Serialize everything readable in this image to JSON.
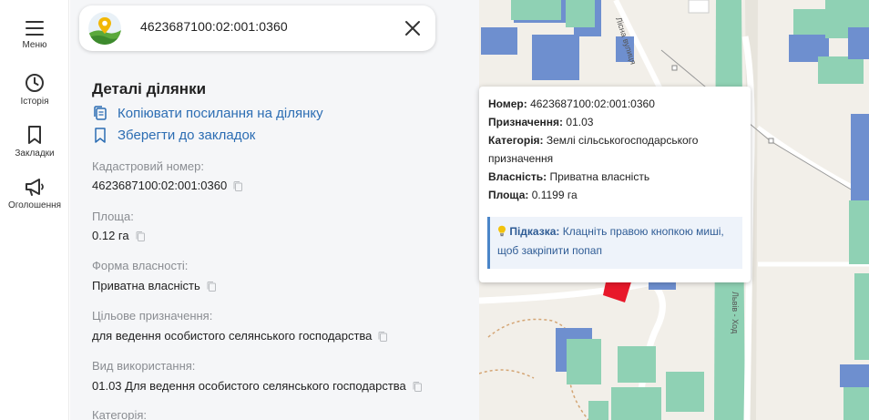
{
  "sidebar": {
    "items": [
      {
        "label": "Меню",
        "icon": "menu-icon"
      },
      {
        "label": "Історія",
        "icon": "clock-icon"
      },
      {
        "label": "Закладки",
        "icon": "bookmark-icon"
      },
      {
        "label": "Оголошення",
        "icon": "megaphone-icon"
      }
    ]
  },
  "search": {
    "value": "4623687100:02:001:0360"
  },
  "details": {
    "title": "Деталі ділянки",
    "copy_link_label": "Копіювати посилання на ділянку",
    "bookmark_label": "Зберегти до закладок",
    "fields": [
      {
        "label": "Кадастровий номер:",
        "value": "4623687100:02:001:0360"
      },
      {
        "label": "Площа:",
        "value": "0.12 га"
      },
      {
        "label": "Форма власності:",
        "value": "Приватна власність"
      },
      {
        "label": "Цільове призначення:",
        "value": "для ведення особистого селянського господарства"
      },
      {
        "label": "Вид використання:",
        "value": "01.03 Для ведення особистого селянського господарства"
      },
      {
        "label": "Категорія:",
        "value": ""
      }
    ]
  },
  "popup": {
    "number_label": "Номер:",
    "number": "4623687100:02:001:0360",
    "purpose_label": "Призначення:",
    "purpose": "01.03",
    "category_label": "Категорія:",
    "category_line1": "Землі сільськогосподарського",
    "category_line2": "призначення",
    "ownership_label": "Власність:",
    "ownership": "Приватна власність",
    "area_label": "Площа:",
    "area": "0.1199 га",
    "hint_label": "Підказка:",
    "hint_line1": "Клацніть правою кнопкою миші,",
    "hint_line2": "щоб закріпити попап"
  },
  "map": {
    "street_label_1": "Лісна вулиця",
    "street_label_2": "Львів - Ход",
    "colors": {
      "land": "#f2efe9",
      "green_parcel": "#8fd1b4",
      "blue_parcel": "#6e8fcf",
      "highlight": "#e8182a",
      "road": "#ffffff"
    }
  }
}
